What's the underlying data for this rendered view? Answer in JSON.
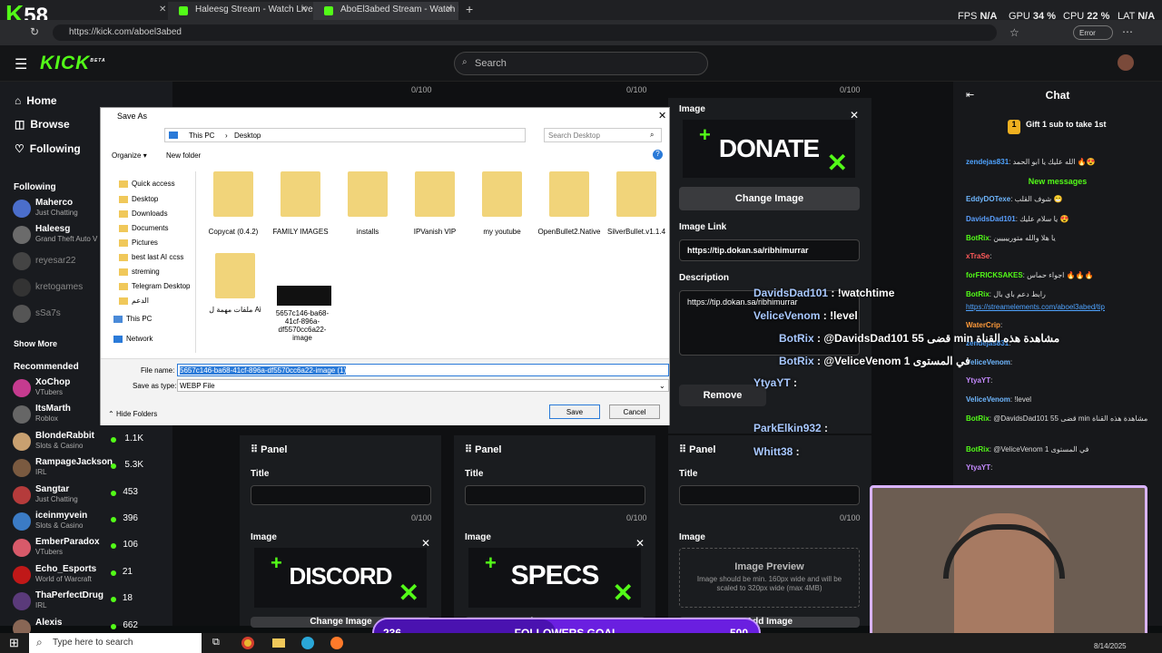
{
  "overlay_stats": {
    "logo_k": "K",
    "logo_num": "58",
    "fps_label": "FPS",
    "fps": "N/A",
    "gpu_label": "GPU",
    "gpu": "34 %",
    "cpu_label": "CPU",
    "cpu": "22 %",
    "lat_label": "LAT",
    "lat": "N/A"
  },
  "browser": {
    "tabs": [
      "Haleesg Stream - Watch Live on K",
      "AboEl3abed Stream - Watch Live"
    ],
    "new_tab": "+",
    "url": "https://kick.com/aboel3abed",
    "error_label": "Error"
  },
  "kick": {
    "logo": "KICK",
    "logo_badge": "BETA",
    "search_placeholder": "Search"
  },
  "sidebar": {
    "nav": [
      "Home",
      "Browse",
      "Following"
    ],
    "following_header": "Following",
    "following": [
      {
        "name": "Maherco",
        "category": "Just Chatting",
        "color": "#4b6ecb"
      },
      {
        "name": "Haleesg",
        "category": "Grand Theft Auto V",
        "color": "#6b6b6b"
      },
      {
        "name": "reyesar22",
        "category": "",
        "color": "#444"
      },
      {
        "name": "kretogames",
        "category": "",
        "color": "#333"
      },
      {
        "name": "sSa7s",
        "category": "",
        "color": "#555"
      }
    ],
    "show_more": "Show More",
    "recommended_header": "Recommended",
    "recommended": [
      {
        "name": "XoChop",
        "category": "VTubers",
        "viewers": "",
        "color": "#c53b8f"
      },
      {
        "name": "ItsMarth",
        "category": "Roblox",
        "viewers": "",
        "color": "#666"
      },
      {
        "name": "BlondeRabbit",
        "category": "Slots & Casino",
        "viewers": "1.1K",
        "color": "#c8a070"
      },
      {
        "name": "RampageJackson",
        "category": "IRL",
        "viewers": "5.3K",
        "color": "#7a5a40"
      },
      {
        "name": "Sangtar",
        "category": "Just Chatting",
        "viewers": "453",
        "color": "#b53b3b"
      },
      {
        "name": "iceinmyvein",
        "category": "Slots & Casino",
        "viewers": "396",
        "color": "#3b7bc5"
      },
      {
        "name": "EmberParadox",
        "category": "VTubers",
        "viewers": "106",
        "color": "#d85a6a"
      },
      {
        "name": "Echo_Esports",
        "category": "World of Warcraft",
        "viewers": "21",
        "color": "#c01818"
      },
      {
        "name": "ThaPerfectDrug",
        "category": "IRL",
        "viewers": "18",
        "color": "#5a3a7a"
      },
      {
        "name": "Alexis",
        "category": "",
        "viewers": "662",
        "color": "#886655"
      }
    ]
  },
  "panels": {
    "count_empty": "0/100",
    "image_label": "Image",
    "change_image": "Change Image",
    "image_link_label": "Image Link",
    "image_link_value": "https://tip.dokan.sa/ribhimurrar",
    "description_label": "Description",
    "description_value": "https://tip.dokan.sa/ribhimurrar",
    "remove": "Remove",
    "panel_label": "Panel",
    "title_label": "Title",
    "banner_donate": "DONATE",
    "banner_discord": "DISCORD",
    "banner_specs": "SPECS",
    "image_preview_title": "Image Preview",
    "image_preview_text": "Image should be min. 160px wide and will be scaled to 320px wide (max 4MB)",
    "add_image": "Add Image"
  },
  "chat": {
    "title": "Chat",
    "gift_text": "Gift 1 sub to take 1st",
    "gift_badge": "1",
    "new_messages": "New messages",
    "messages": [
      {
        "user": "zendejas831",
        "text": "الله عليك يا ابو الحمد 🔥😍",
        "color": "#4fa3ff"
      },
      {
        "user": "EddyDOTexe",
        "text": "شوف القلب 😁",
        "color": "#6fb7ff"
      },
      {
        "user": "DavidsDad101",
        "text": "يا سلام عليك 😍",
        "color": "#5aa0ff"
      },
      {
        "user": "BotRix",
        "text": "يا هلا والله متورييييين",
        "color": "#53fc18"
      },
      {
        "user": "xTraSe",
        "text": "",
        "color": "#ff5a5a"
      },
      {
        "user": "forFRICKSAKES",
        "text": "اجواء حماس 🔥🔥🔥",
        "color": "#53fc18"
      },
      {
        "user": "BotRix",
        "text": "رابط دعم باي بال",
        "color": "#53fc18"
      },
      {
        "user": "",
        "text": "https://streamelements.com/aboel3abed/tip",
        "color": "#4fa3ff"
      },
      {
        "user": "WaterCrip",
        "text": "",
        "color": "#ff9a3a"
      },
      {
        "user": "zendejas831",
        "text": "",
        "color": "#4fa3ff"
      },
      {
        "user": "VeliceVenom",
        "text": "",
        "color": "#6fb7ff"
      },
      {
        "user": "YtyaYT",
        "text": "",
        "color": "#c58aff"
      },
      {
        "user": "VeliceVenom",
        "text": "!level",
        "color": "#6fb7ff"
      },
      {
        "user": "BotRix",
        "text": "@DavidsDad101 55 قضى min مشاهدة هذه القناة",
        "color": "#53fc18"
      },
      {
        "user": "BotRix",
        "text": "@VeliceVenom 1 في المستوى",
        "color": "#53fc18"
      },
      {
        "user": "YtyaYT",
        "text": "",
        "color": "#c58aff"
      }
    ]
  },
  "overlay_chat": [
    {
      "user": "DavidsDad101",
      "text": "!watchtime"
    },
    {
      "user": "VeliceVenom",
      "text": "!level"
    },
    {
      "user": "BotRix",
      "text": "@DavidsDad101 55 قضى min مشاهدة هذه القناة"
    },
    {
      "user": "BotRix",
      "text": "@VeliceVenom 1 في المستوى"
    },
    {
      "user": "YtyaYT",
      "text": ""
    },
    {
      "user": "ParkElkin932",
      "text": ""
    },
    {
      "user": "Whitt38",
      "text": ""
    }
  ],
  "dialog": {
    "title": "Save As",
    "breadcrumb": [
      "This PC",
      "Desktop"
    ],
    "search_placeholder": "Search Desktop",
    "organize": "Organize",
    "new_folder": "New folder",
    "tree": [
      "Quick access",
      "Desktop",
      "Downloads",
      "Documents",
      "Pictures",
      "best last AI ccss",
      "streming",
      "Telegram Desktop",
      "الدعم",
      "This PC",
      "Network"
    ],
    "files": [
      "Copycat (0.4.2)",
      "FAMILY IMAGES",
      "installs",
      "IPVanish VIP",
      "my youtube",
      "OpenBullet2.Native",
      "SilverBullet.v1.1.4",
      "ملفات مهمة ل Ai",
      "5657c146-ba68-41cf-896a-df5570cc6a22-image"
    ],
    "file_name_label": "File name:",
    "file_name_value": "5657c146-ba68-41cf-896a-df5570cc6a22-image (1)",
    "save_as_type_label": "Save as type:",
    "save_as_type_value": "WEBP File",
    "hide_folders": "Hide Folders",
    "save": "Save",
    "cancel": "Cancel"
  },
  "goal": {
    "current": "236",
    "label": "FOLLOWERS GOAL",
    "target": "500",
    "progress": 0.472
  },
  "taskbar": {
    "search_placeholder": "Type here to search",
    "date": "8/14/2025"
  }
}
